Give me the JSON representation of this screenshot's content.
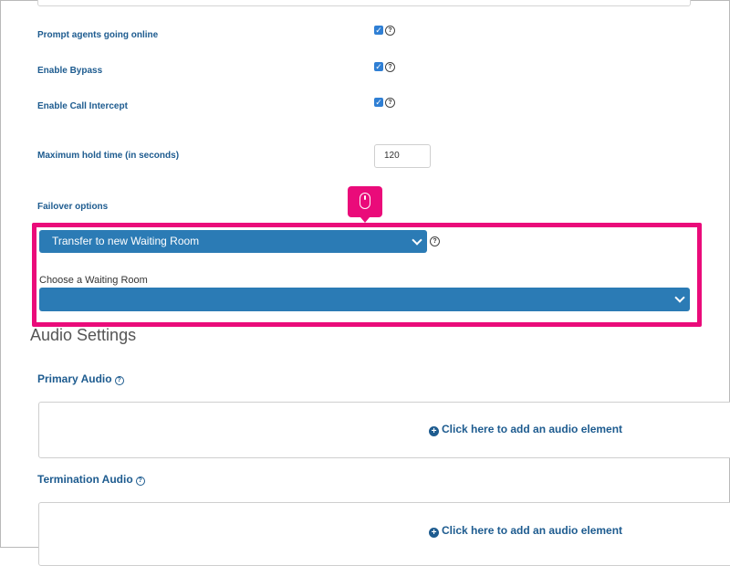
{
  "settings": {
    "prompt_agents_label": "Prompt agents going online",
    "enable_bypass_label": "Enable Bypass",
    "enable_call_intercept_label": "Enable Call Intercept",
    "max_hold_label": "Maximum hold time (in seconds)",
    "max_hold_value": "120",
    "failover_label": "Failover options",
    "checkbox_glyph": "✓",
    "help_glyph": "?"
  },
  "failover": {
    "selected": "Transfer to new Waiting Room",
    "choose_room_label": "Choose a Waiting Room",
    "choose_room_value": ""
  },
  "audio": {
    "heading": "Audio Settings",
    "primary_title": "Primary Audio",
    "termination_title": "Termination Audio",
    "add_label": "Click here to add an audio element",
    "plus_glyph": "+"
  },
  "colors": {
    "accent": "#2b7bb5",
    "label_blue": "#1d5b8f",
    "highlight": "#ea0b7a"
  },
  "icons": {
    "tooltip": "mouse-icon"
  }
}
